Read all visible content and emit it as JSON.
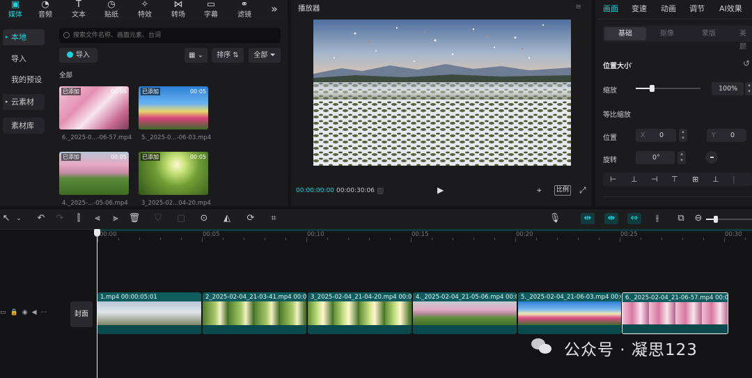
{
  "toolbar": {
    "tools": [
      {
        "label": "媒体",
        "icon": "media-icon",
        "active": true
      },
      {
        "label": "音频",
        "icon": "audio-icon"
      },
      {
        "label": "文本",
        "icon": "text-icon"
      },
      {
        "label": "贴纸",
        "icon": "sticker-icon"
      },
      {
        "label": "特效",
        "icon": "effects-icon"
      },
      {
        "label": "转场",
        "icon": "transition-icon"
      },
      {
        "label": "字幕",
        "icon": "subtitle-icon"
      },
      {
        "label": "滤镜",
        "icon": "filter-icon"
      }
    ],
    "more": "»"
  },
  "sidebar": {
    "items": [
      "本地",
      "导入",
      "我的预设",
      "云素材",
      "素材库"
    ]
  },
  "media": {
    "search_placeholder": "搜索文件名称、画面元素、台词",
    "import_label": "导入",
    "sort_label": "排序",
    "all_filter_label": "全部",
    "section_label": "全部",
    "added_tag": "已添加",
    "items": [
      {
        "name": "6._2025-0...-06-57.mp4",
        "duration": "00:06"
      },
      {
        "name": "5._2025-0...-06-03.mp4",
        "duration": "00:05"
      },
      {
        "name": "4._2025-...-05-06.mp4",
        "duration": "00:05"
      },
      {
        "name": "3_2025-02...04-20.mp4",
        "duration": "00:05"
      }
    ]
  },
  "player": {
    "title": "播放器",
    "current_time": "00:00:00:00",
    "total_time": "00:00:30:06",
    "ratio_label": "比例"
  },
  "inspector": {
    "tabs": [
      "画面",
      "变速",
      "动画",
      "调节",
      "AI效果"
    ],
    "subtabs": [
      "基础",
      "抠像",
      "蒙版",
      "美颜"
    ],
    "section_title": "位置大小",
    "scale_label": "缩放",
    "scale_value": "100%",
    "scale_level": 0.25,
    "uniform_scale_label": "等比缩放",
    "position_label": "位置",
    "pos_x_label": "X",
    "pos_x_value": "0",
    "pos_y_label": "Y",
    "pos_y_value": "0",
    "rotation_label": "旋转",
    "rotation_value": "0°"
  },
  "timeline": {
    "ruler": [
      "00:00",
      "00:05",
      "00:10",
      "00:15",
      "00:20",
      "00:25",
      "00:30"
    ],
    "cover_label": "封面",
    "clips": [
      {
        "caption": "1.mp4   00:00:05:01",
        "theme": "snow"
      },
      {
        "caption": "2_2025-02-04_21-03-41.mp4   00:00:",
        "theme": "grass"
      },
      {
        "caption": "3_2025-02-04_21-04-20.mp4   00:00:",
        "theme": "grass"
      },
      {
        "caption": "4._2025-02-04_21-05-06.mp4   00:0",
        "theme": "park"
      },
      {
        "caption": "5._2025-02-04_21-06-03.mp4   00:00",
        "theme": "flowers"
      },
      {
        "caption": "6._2025-02-04_21-06-57.mp4   00:00",
        "theme": "blossom"
      }
    ]
  },
  "watermark": "公众号 · 凝思123"
}
